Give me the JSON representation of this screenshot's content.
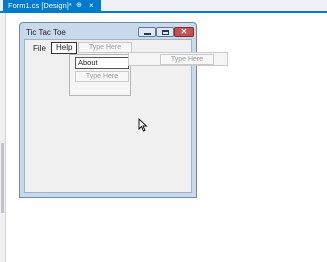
{
  "document_tab": {
    "label": "Form1.cs [Design]*",
    "pin_glyph": "⊕",
    "close_glyph": "×"
  },
  "form": {
    "title": "Tic Tac Toe",
    "caption_buttons": {
      "minimize_icon": "minimize-icon",
      "maximize_icon": "maximize-icon",
      "close_icon": "close-icon",
      "close_glyph": "✕"
    }
  },
  "menu": {
    "items": [
      {
        "label": "File"
      },
      {
        "label": "Help"
      }
    ],
    "placeholder": "Type Here"
  },
  "help_dropdown": {
    "items": [
      {
        "label": "About"
      }
    ],
    "placeholder": "Type Here"
  },
  "submenu_hint": {
    "placeholder": "Type Here"
  },
  "colors": {
    "accent": "#007acc",
    "form_border": "#6d8aa8",
    "close_button": "#c75050"
  }
}
